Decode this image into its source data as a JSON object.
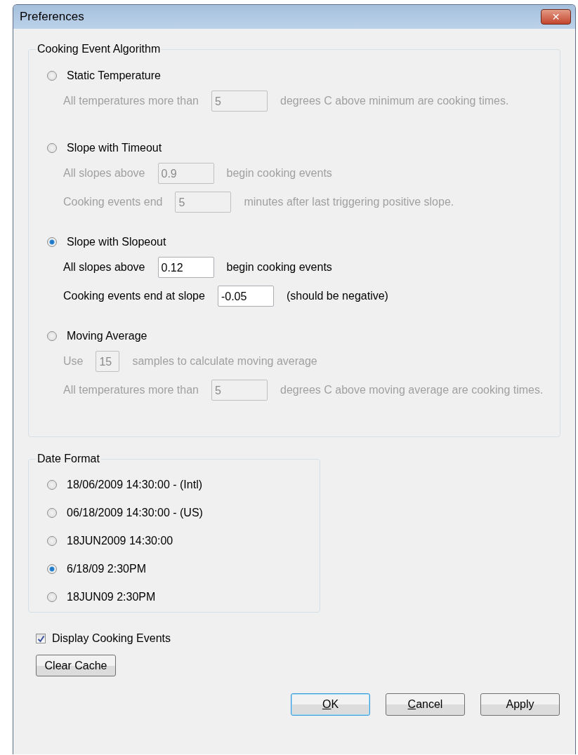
{
  "window": {
    "title": "Preferences",
    "close": "✕"
  },
  "algorithm_group": {
    "title": "Cooking Event Algorithm",
    "options": [
      {
        "label": "Static Temperature",
        "selected": false,
        "settings": [
          {
            "label": "All temperatures more than",
            "value": "5",
            "suffix": "degrees C above minimum are cooking times."
          }
        ]
      },
      {
        "label": "Slope with Timeout",
        "selected": false,
        "settings": [
          {
            "label": "All slopes above",
            "value": "0.9",
            "suffix": "begin cooking events"
          },
          {
            "label": "Cooking events end",
            "value": "5",
            "suffix": "minutes after last triggering positive slope."
          }
        ]
      },
      {
        "label": "Slope with Slopeout",
        "selected": true,
        "settings": [
          {
            "label": "All slopes above",
            "value": "0.12",
            "suffix": "begin cooking events"
          },
          {
            "label": "Cooking events end at slope",
            "value": "-0.05",
            "suffix": "(should be negative)"
          }
        ]
      },
      {
        "label": "Moving Average",
        "selected": false,
        "settings": [
          {
            "label": "Use",
            "value": "15",
            "suffix": "samples to calculate moving average"
          },
          {
            "label": "All temperatures more than",
            "value": "5",
            "suffix": "degrees C above moving average are cooking times."
          }
        ]
      }
    ]
  },
  "date_format_group": {
    "title": "Date Format",
    "options": [
      {
        "label": "18/06/2009 14:30:00 - (Intl)",
        "selected": false
      },
      {
        "label": "06/18/2009 14:30:00 - (US)",
        "selected": false
      },
      {
        "label": "18JUN2009 14:30:00",
        "selected": false
      },
      {
        "label": "6/18/09 2:30PM",
        "selected": true
      },
      {
        "label": "18JUN09 2:30PM",
        "selected": false
      }
    ]
  },
  "display_cooking_events": {
    "label": "Display Cooking Events",
    "checked": true
  },
  "clear_cache_button": {
    "label": "Clear Cache"
  },
  "buttons": [
    {
      "label": "OK",
      "access_key_underlined": true,
      "default": true
    },
    {
      "label": "Cancel",
      "access_key_underlined": true,
      "default": false
    },
    {
      "label": "Apply",
      "access_key_underlined": false,
      "default": false
    }
  ]
}
